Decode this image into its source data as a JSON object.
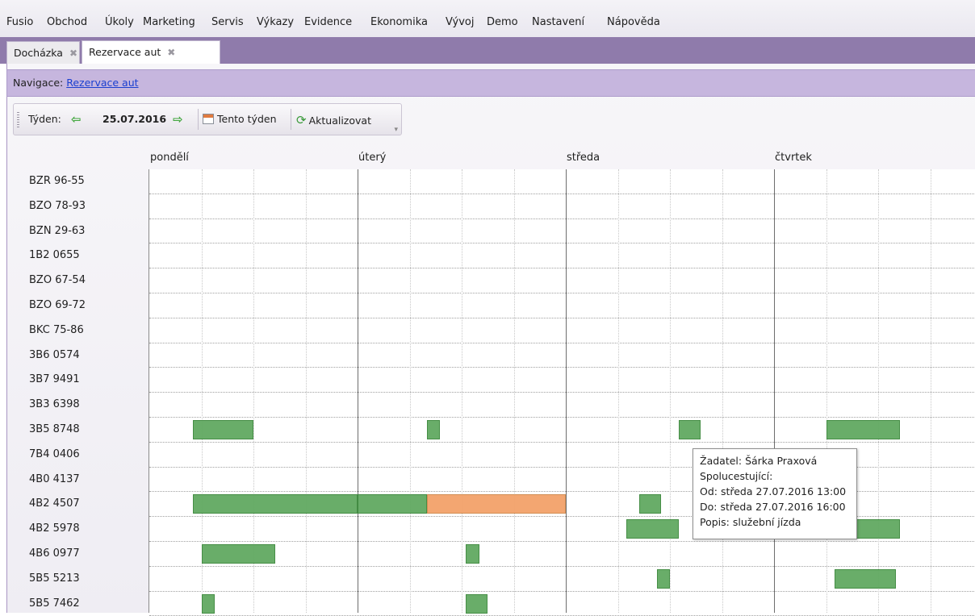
{
  "menu": [
    "Fusio",
    "Obchod",
    "Úkoly",
    "Marketing",
    "Servis",
    "Výkazy",
    "Evidence",
    "Ekonomika",
    "Vývoj",
    "Demo",
    "Nastavení",
    "Nápověda"
  ],
  "tabs": [
    {
      "label": "Docházka",
      "close": "✖"
    },
    {
      "label": "Rezervace aut",
      "close": "✖"
    }
  ],
  "navigation": {
    "label": "Navigace:",
    "link": "Rezervace aut"
  },
  "toolbar": {
    "week_label": "Týden:",
    "prev_icon": "⇦",
    "date": "25.07.2016",
    "next_icon": "⇨",
    "this_week": "Tento týden",
    "refresh": "Aktualizovat"
  },
  "days": [
    "pondělí",
    "úterý",
    "středa",
    "čtvrtek"
  ],
  "vehicles": [
    "BZR 96-55",
    "BZO 78-93",
    "BZN 29-63",
    "1B2 0655",
    "BZO 67-54",
    "BZO 69-72",
    "BKC 75-86",
    "3B6 0574",
    "3B7 9491",
    "3B3 6398",
    "3B5 8748",
    "7B4 0406",
    "4B0 4137",
    "4B2 4507",
    "4B2 5978",
    "4B6 0977",
    "5B5 5213",
    "5B5 7462"
  ],
  "reservations": [
    {
      "vehicle": "3B5 8748",
      "day": 0,
      "from": 5,
      "to": 12
    },
    {
      "vehicle": "3B5 8748",
      "day": 1,
      "from": 8,
      "to": 9.5
    },
    {
      "vehicle": "3B5 8748",
      "day": 2,
      "from": 13,
      "to": 15.5
    },
    {
      "vehicle": "3B5 8748",
      "day": 3,
      "from": 6,
      "to": 14.5
    },
    {
      "vehicle": "4B2 4507",
      "day": 0,
      "from": 5,
      "to": 24
    },
    {
      "vehicle": "4B2 4507",
      "day": 1,
      "from": 0,
      "to": 8
    },
    {
      "vehicle": "4B2 4507",
      "day": 1,
      "from": 8,
      "to": 24,
      "conflict": true
    },
    {
      "vehicle": "4B2 4507",
      "day": 2,
      "from": 8.5,
      "to": 11
    },
    {
      "vehicle": "4B2 5978",
      "day": 2,
      "from": 7,
      "to": 13
    },
    {
      "vehicle": "4B2 5978",
      "day": 3,
      "from": 8,
      "to": 14.5
    },
    {
      "vehicle": "4B6 0977",
      "day": 0,
      "from": 6,
      "to": 14.5
    },
    {
      "vehicle": "4B6 0977",
      "day": 1,
      "from": 12.5,
      "to": 14
    },
    {
      "vehicle": "5B5 5213",
      "day": 2,
      "from": 10.5,
      "to": 12
    },
    {
      "vehicle": "5B5 5213",
      "day": 3,
      "from": 7,
      "to": 14
    },
    {
      "vehicle": "5B5 7462",
      "day": 0,
      "from": 6,
      "to": 7.5
    },
    {
      "vehicle": "5B5 7462",
      "day": 1,
      "from": 12.5,
      "to": 15
    }
  ],
  "tooltip": {
    "applicant": "Žadatel: Šárka Praxová",
    "companions": "Spolucestující:",
    "from": "Od: středa 27.07.2016 13:00",
    "to": "Do: středa 27.07.2016 16:00",
    "description": "Popis: služební jízda"
  },
  "colors": {
    "accent": "#8f7bab",
    "nav": "#c6b6de",
    "booking": "#63aa63",
    "conflict": "#f3a36c"
  }
}
